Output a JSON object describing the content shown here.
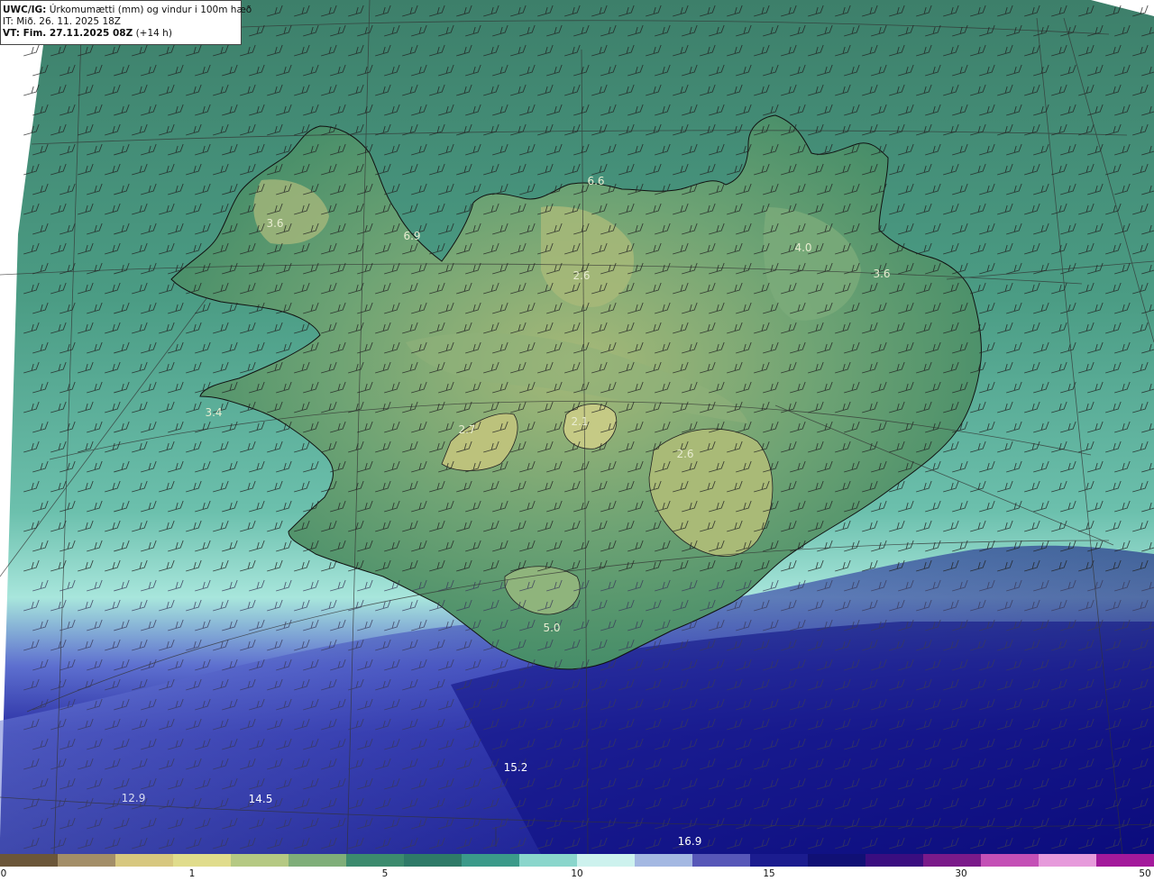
{
  "header": {
    "line1_prefix": "UWC/IG:",
    "line1_text": "Úrkomumætti (mm) og vindur i 100m hæð",
    "line2_text": "IT: Mið. 26. 11. 2025 18Z",
    "line3_prefix": "VT: Fim. 27.11.2025 08Z",
    "line3_text": "(+14 h)"
  },
  "colorbar": {
    "ticks": [
      "0",
      "1",
      "5",
      "10",
      "15",
      "30",
      "50"
    ],
    "colors": [
      "#6b5639",
      "#a38e68",
      "#d7c77f",
      "#e0dc8c",
      "#b5c983",
      "#7fae79",
      "#3c8b6e",
      "#2e7a68",
      "#3b9a8a",
      "#8ad6cc",
      "#cdf2ee",
      "#a4b8e2",
      "#5757b8",
      "#1b1c8f",
      "#101075",
      "#3a0d80",
      "#7a1a8a",
      "#c450b6",
      "#e69adb",
      "#a3199b"
    ]
  },
  "map_values": [
    {
      "label": "3.6",
      "color": "#e8ecd0"
    },
    {
      "label": "6.9",
      "color": "#e8ecd0"
    },
    {
      "label": "6.6",
      "color": "#e8ecd0"
    },
    {
      "label": "2.6",
      "color": "#e8ecd0"
    },
    {
      "label": "4.0",
      "color": "#e8ecd0"
    },
    {
      "label": "3.6",
      "color": "#e8ecd0"
    },
    {
      "label": "3.4",
      "color": "#e8ecd0"
    },
    {
      "label": "2.7",
      "color": "#e8ecd0"
    },
    {
      "label": "2.1",
      "color": "#e8ecd0"
    },
    {
      "label": "2.6",
      "color": "#e8ecd0"
    },
    {
      "label": "5.0",
      "color": "#e8ecd0"
    },
    {
      "label": "15.2",
      "color": "#ffffff"
    },
    {
      "label": "12.9",
      "color": "#d8dcf0"
    },
    {
      "label": "14.5",
      "color": "#ffffff"
    },
    {
      "label": "16.9",
      "color": "#ffffff"
    }
  ],
  "palette": {
    "ocean_north": "#3d8a72",
    "ocean_mid": "#4fa58d",
    "ocean_light": "#9fe3da",
    "ocean_blue": "#3b3fb0",
    "ocean_deep": "#0b0c80",
    "land_low": "#3f8a66",
    "land_high": "#b9c27a"
  }
}
